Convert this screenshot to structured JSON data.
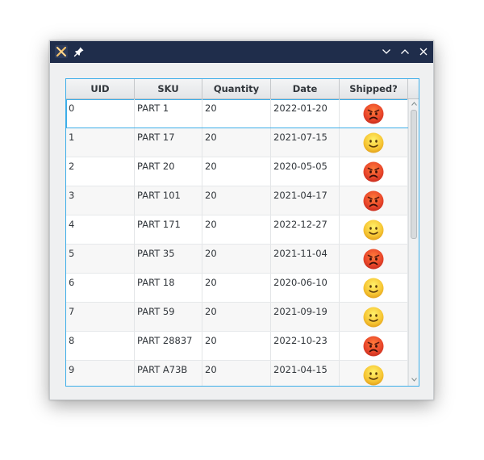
{
  "window": {
    "title": "",
    "colors": {
      "titlebar": "#1f2d4b",
      "accent": "#3daee9"
    }
  },
  "table": {
    "columns": [
      "UID",
      "SKU",
      "Quantity",
      "Date",
      "Shipped?"
    ],
    "rows": [
      {
        "uid": "0",
        "sku": "PART 1",
        "quantity": "20",
        "date": "2022-01-20",
        "shipped": "angry-face-icon"
      },
      {
        "uid": "1",
        "sku": "PART 17",
        "quantity": "20",
        "date": "2021-07-15",
        "shipped": "smiling-face-icon"
      },
      {
        "uid": "2",
        "sku": "PART 20",
        "quantity": "20",
        "date": "2020-05-05",
        "shipped": "angry-face-icon"
      },
      {
        "uid": "3",
        "sku": "PART 101",
        "quantity": "20",
        "date": "2021-04-17",
        "shipped": "angry-face-icon"
      },
      {
        "uid": "4",
        "sku": "PART 171",
        "quantity": "20",
        "date": "2022-12-27",
        "shipped": "smiling-face-icon"
      },
      {
        "uid": "5",
        "sku": "PART 35",
        "quantity": "20",
        "date": "2021-11-04",
        "shipped": "angry-face-icon"
      },
      {
        "uid": "6",
        "sku": "PART 18",
        "quantity": "20",
        "date": "2020-06-10",
        "shipped": "smiling-face-icon"
      },
      {
        "uid": "7",
        "sku": "PART 59",
        "quantity": "20",
        "date": "2021-09-19",
        "shipped": "smiling-face-icon"
      },
      {
        "uid": "8",
        "sku": "PART 28837",
        "quantity": "20",
        "date": "2022-10-23",
        "shipped": "angry-face-icon"
      },
      {
        "uid": "9",
        "sku": "PART A73B",
        "quantity": "20",
        "date": "2021-04-15",
        "shipped": "smiling-face-icon"
      }
    ],
    "selected_row": 0
  }
}
